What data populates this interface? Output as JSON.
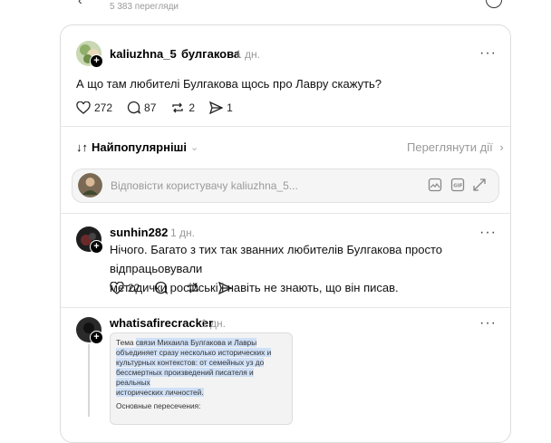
{
  "top": {
    "views": "5 383 перегляди"
  },
  "post": {
    "username": "kaliuzhna_5",
    "topic": "булгакова",
    "time": "1 дн.",
    "text": "А що там любителі Булгакова щось про Лавру скажуть?",
    "likes": "272",
    "comments": "87",
    "reposts": "2",
    "shares": "1"
  },
  "sort": {
    "label": "Найпопулярніші",
    "activity": "Переглянути дії"
  },
  "reply": {
    "placeholder": "Відповісти користувачу kaliuzhna_5..."
  },
  "comment1": {
    "username": "sunhin282",
    "time": "1 дн.",
    "line1": "Нічого. Багато з тих так званних любителів Булгакова просто відпрацьовували",
    "line2": "методички російські і навіть не знають, що він писав.",
    "likes": "22"
  },
  "comment2": {
    "username": "whatisafirecracker",
    "time": "1 дн.",
    "shot_line1_a": "Тема ",
    "shot_line1_b": "связи Михаила Булгакова и Лавры",
    "shot_line2": "объединяет сразу несколько исторических и",
    "shot_line3": "культурных контекстов: от семейных уз до",
    "shot_line4": "бессмертных произведений писателя и реальных",
    "shot_line5": "исторических личностей.",
    "shot_line6": "Основные пересечения:"
  }
}
